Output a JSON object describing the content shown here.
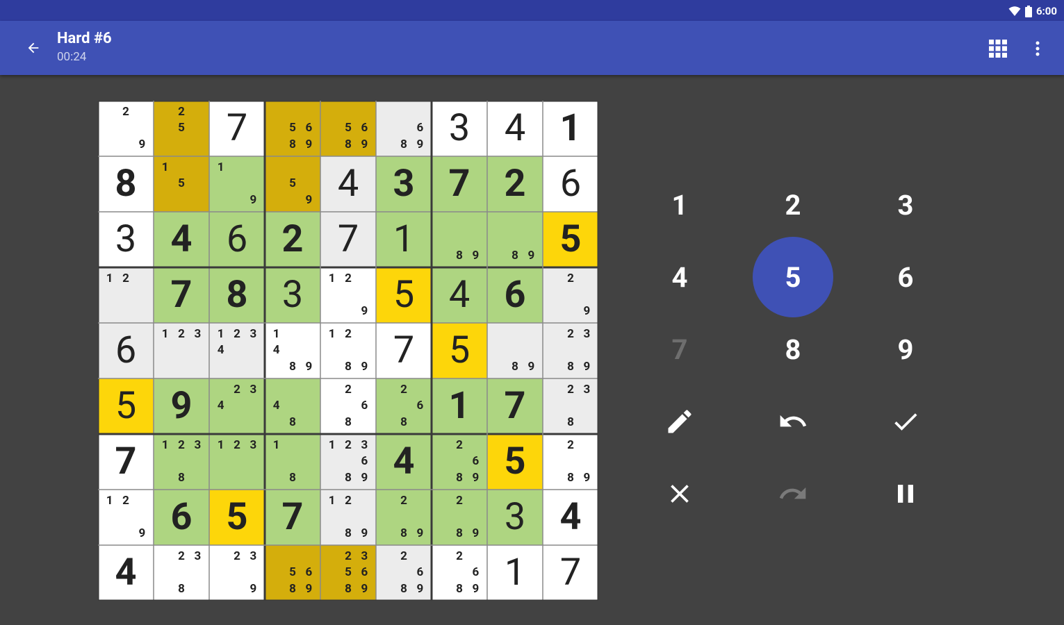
{
  "status_bar": {
    "time": "6:00",
    "icons": [
      "wifi-icon",
      "battery-icon"
    ]
  },
  "app_bar": {
    "back_icon": "arrow-back-icon",
    "title": "Hard #6",
    "timer": "00:24",
    "grid_icon": "grid-view-icon",
    "more_icon": "more-vert-icon"
  },
  "colors": {
    "primary": "#3f51b5",
    "primary_dark": "#2f3c9e",
    "background": "#424242",
    "cell_white": "#ffffff",
    "cell_gray": "#ececec",
    "cell_green": "#aed581",
    "cell_yellow": "#fdd60a",
    "cell_olive": "#d4ae0c"
  },
  "board": {
    "rows": [
      [
        {
          "bg": "w",
          "notes": [
            2,
            9
          ]
        },
        {
          "bg": "o",
          "notes": [
            2,
            5
          ]
        },
        {
          "bg": "w",
          "v": "7",
          "given": false
        },
        {
          "bg": "o",
          "notes": [
            5,
            6,
            8,
            9
          ]
        },
        {
          "bg": "o",
          "notes": [
            5,
            6,
            8,
            9
          ]
        },
        {
          "bg": "g",
          "notes": [
            6,
            8,
            9
          ]
        },
        {
          "bg": "w",
          "v": "3",
          "given": false
        },
        {
          "bg": "w",
          "v": "4",
          "given": false
        },
        {
          "bg": "w",
          "v": "1",
          "given": true
        }
      ],
      [
        {
          "bg": "w",
          "v": "8",
          "given": true
        },
        {
          "bg": "o",
          "notes": [
            1,
            5
          ]
        },
        {
          "bg": "l",
          "notes": [
            1,
            9
          ]
        },
        {
          "bg": "o",
          "notes": [
            5,
            9
          ]
        },
        {
          "bg": "g",
          "v": "4",
          "given": false
        },
        {
          "bg": "l",
          "v": "3",
          "given": true
        },
        {
          "bg": "l",
          "v": "7",
          "given": true
        },
        {
          "bg": "l",
          "v": "2",
          "given": true
        },
        {
          "bg": "w",
          "v": "6",
          "given": false
        }
      ],
      [
        {
          "bg": "w",
          "v": "3",
          "given": false
        },
        {
          "bg": "l",
          "v": "4",
          "given": true
        },
        {
          "bg": "l",
          "v": "6",
          "given": false
        },
        {
          "bg": "l",
          "v": "2",
          "given": true
        },
        {
          "bg": "g",
          "v": "7",
          "given": false
        },
        {
          "bg": "l",
          "v": "1",
          "given": false
        },
        {
          "bg": "l",
          "notes": [
            8,
            9
          ]
        },
        {
          "bg": "l",
          "notes": [
            8,
            9
          ]
        },
        {
          "bg": "y",
          "v": "5",
          "given": true
        }
      ],
      [
        {
          "bg": "g",
          "notes": [
            1,
            2
          ]
        },
        {
          "bg": "l",
          "v": "7",
          "given": true
        },
        {
          "bg": "l",
          "v": "8",
          "given": true
        },
        {
          "bg": "l",
          "v": "3",
          "given": false
        },
        {
          "bg": "w",
          "notes": [
            1,
            2,
            9
          ]
        },
        {
          "bg": "y",
          "v": "5",
          "given": false
        },
        {
          "bg": "l",
          "v": "4",
          "given": false
        },
        {
          "bg": "l",
          "v": "6",
          "given": true
        },
        {
          "bg": "g",
          "notes": [
            2,
            9
          ]
        }
      ],
      [
        {
          "bg": "g",
          "v": "6",
          "given": false
        },
        {
          "bg": "g",
          "notes": [
            1,
            2,
            3
          ]
        },
        {
          "bg": "g",
          "notes": [
            1,
            2,
            3,
            4
          ]
        },
        {
          "bg": "w",
          "notes": [
            1,
            4,
            8,
            9
          ]
        },
        {
          "bg": "w",
          "notes": [
            1,
            2,
            8,
            9
          ]
        },
        {
          "bg": "w",
          "v": "7",
          "given": false
        },
        {
          "bg": "y",
          "v": "5",
          "given": false
        },
        {
          "bg": "g",
          "notes": [
            8,
            9
          ]
        },
        {
          "bg": "g",
          "notes": [
            2,
            3,
            8,
            9
          ]
        }
      ],
      [
        {
          "bg": "y",
          "v": "5",
          "given": false
        },
        {
          "bg": "l",
          "v": "9",
          "given": true
        },
        {
          "bg": "l",
          "notes": [
            2,
            3,
            4
          ]
        },
        {
          "bg": "l",
          "notes": [
            4,
            8
          ]
        },
        {
          "bg": "w",
          "notes": [
            2,
            6,
            8
          ]
        },
        {
          "bg": "l",
          "notes": [
            2,
            6,
            8
          ]
        },
        {
          "bg": "l",
          "v": "1",
          "given": true
        },
        {
          "bg": "l",
          "v": "7",
          "given": true
        },
        {
          "bg": "g",
          "notes": [
            2,
            3,
            8
          ]
        }
      ],
      [
        {
          "bg": "w",
          "v": "7",
          "given": true
        },
        {
          "bg": "l",
          "notes": [
            1,
            2,
            3,
            8
          ]
        },
        {
          "bg": "l",
          "notes": [
            1,
            2,
            3
          ]
        },
        {
          "bg": "l",
          "notes": [
            1,
            8
          ]
        },
        {
          "bg": "g",
          "notes": [
            1,
            2,
            3,
            6,
            8,
            9
          ]
        },
        {
          "bg": "l",
          "v": "4",
          "given": true
        },
        {
          "bg": "l",
          "notes": [
            2,
            6,
            8,
            9
          ]
        },
        {
          "bg": "y",
          "v": "5",
          "given": true
        },
        {
          "bg": "w",
          "notes": [
            2,
            8,
            9
          ]
        }
      ],
      [
        {
          "bg": "w",
          "notes": [
            1,
            2,
            9
          ]
        },
        {
          "bg": "l",
          "v": "6",
          "given": true
        },
        {
          "bg": "y",
          "v": "5",
          "given": true
        },
        {
          "bg": "l",
          "v": "7",
          "given": true
        },
        {
          "bg": "g",
          "notes": [
            1,
            2,
            8,
            9
          ]
        },
        {
          "bg": "l",
          "notes": [
            2,
            8,
            9
          ]
        },
        {
          "bg": "l",
          "notes": [
            2,
            8,
            9
          ]
        },
        {
          "bg": "l",
          "v": "3",
          "given": false
        },
        {
          "bg": "w",
          "v": "4",
          "given": true
        }
      ],
      [
        {
          "bg": "w",
          "v": "4",
          "given": true
        },
        {
          "bg": "w",
          "notes": [
            2,
            3,
            8
          ]
        },
        {
          "bg": "w",
          "notes": [
            2,
            3,
            9
          ]
        },
        {
          "bg": "o",
          "notes": [
            5,
            6,
            8,
            9
          ]
        },
        {
          "bg": "o",
          "notes": [
            2,
            3,
            5,
            6,
            8,
            9
          ]
        },
        {
          "bg": "g",
          "notes": [
            2,
            6,
            8,
            9
          ]
        },
        {
          "bg": "w",
          "notes": [
            2,
            6,
            8,
            9
          ]
        },
        {
          "bg": "w",
          "v": "1",
          "given": false
        },
        {
          "bg": "w",
          "v": "7",
          "given": false
        }
      ]
    ]
  },
  "keypad": {
    "numbers": [
      {
        "label": "1",
        "disabled": false,
        "selected": false
      },
      {
        "label": "2",
        "disabled": false,
        "selected": false
      },
      {
        "label": "3",
        "disabled": false,
        "selected": false
      },
      {
        "label": "4",
        "disabled": false,
        "selected": false
      },
      {
        "label": "5",
        "disabled": false,
        "selected": true
      },
      {
        "label": "6",
        "disabled": false,
        "selected": false
      },
      {
        "label": "7",
        "disabled": true,
        "selected": false
      },
      {
        "label": "8",
        "disabled": false,
        "selected": false
      },
      {
        "label": "9",
        "disabled": false,
        "selected": false
      }
    ],
    "tools": [
      {
        "icon": "pencil-icon",
        "name": "notes-button",
        "enabled": true
      },
      {
        "icon": "undo-icon",
        "name": "undo-button",
        "enabled": true
      },
      {
        "icon": "check-icon",
        "name": "check-button",
        "enabled": true
      },
      {
        "icon": "close-icon",
        "name": "clear-button",
        "enabled": true
      },
      {
        "icon": "redo-icon",
        "name": "redo-button",
        "enabled": false
      },
      {
        "icon": "pause-icon",
        "name": "pause-button",
        "enabled": true
      }
    ]
  }
}
